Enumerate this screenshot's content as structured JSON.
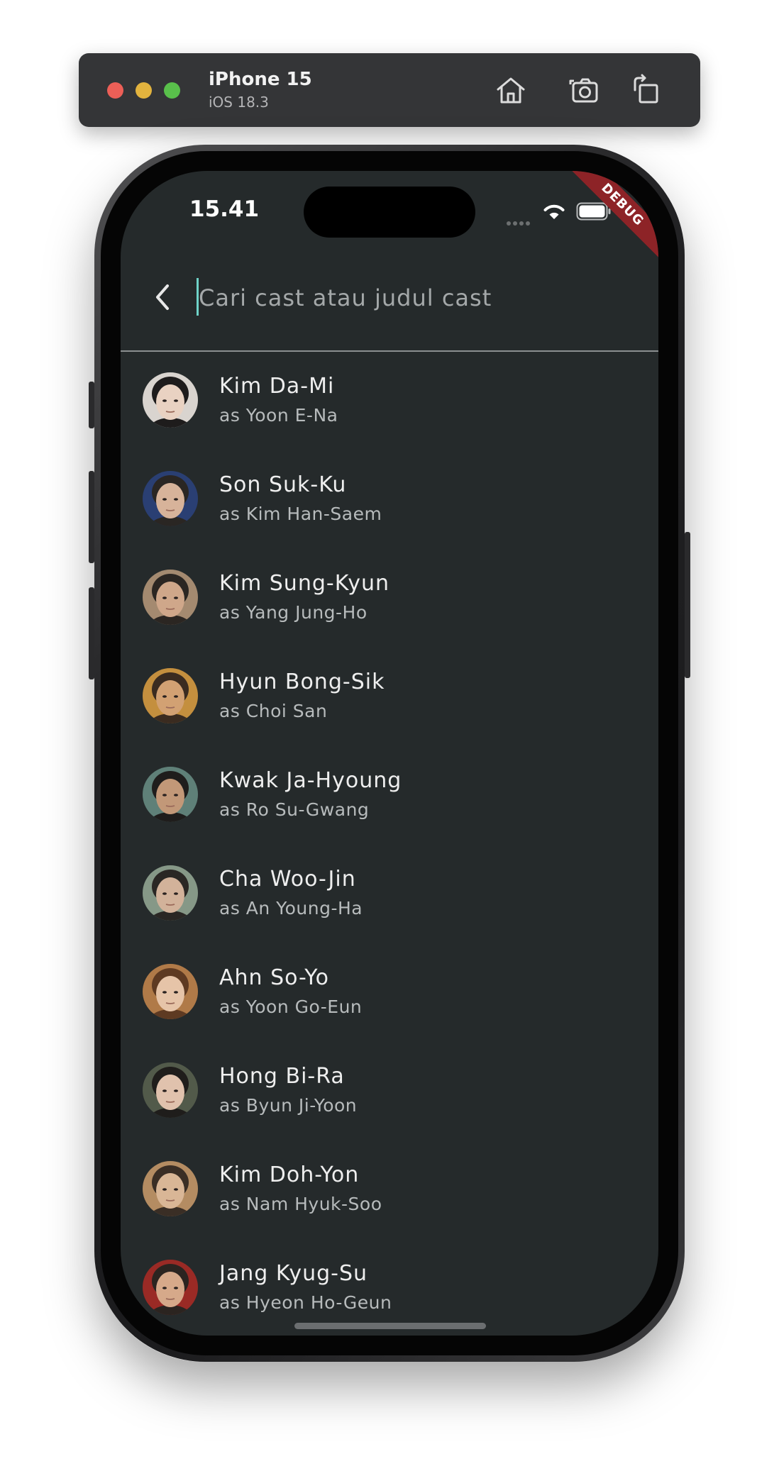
{
  "simulator": {
    "device_name": "iPhone 15",
    "os_version": "iOS 18.3",
    "toolbar_icons": [
      "home-icon",
      "screenshot-icon",
      "rotate-icon"
    ]
  },
  "status_bar": {
    "time": "15.41",
    "debug_label": "DEBUG"
  },
  "appbar": {
    "back_icon": "chevron-left-icon",
    "search_placeholder": "Cari cast atau judul cast",
    "search_value": ""
  },
  "colors": {
    "screen_bg": "#252a2b",
    "accent_caret": "#6fd3c8",
    "debug_banner": "#8d2327",
    "divider": "#8b8f90"
  },
  "cast": [
    {
      "name": "Kim Da-Mi",
      "role": "as Yoon E-Na",
      "avatar_bg": "#d9d4cf",
      "avatar_skin": "#e9d2c2",
      "avatar_hair": "#1e1c1c"
    },
    {
      "name": "Son Suk-Ku",
      "role": "as Kim Han-Saem",
      "avatar_bg": "#2a3f73",
      "avatar_skin": "#d7b39a",
      "avatar_hair": "#2a2623"
    },
    {
      "name": "Kim Sung-Kyun",
      "role": "as Yang Jung-Ho",
      "avatar_bg": "#a48a70",
      "avatar_skin": "#cfa78a",
      "avatar_hair": "#2b2622"
    },
    {
      "name": "Hyun Bong-Sik",
      "role": "as Choi San",
      "avatar_bg": "#c48f3e",
      "avatar_skin": "#d2a173",
      "avatar_hair": "#3a2b20"
    },
    {
      "name": "Kwak Ja-Hyoung",
      "role": "as Ro Su-Gwang",
      "avatar_bg": "#5f8078",
      "avatar_skin": "#c29878",
      "avatar_hair": "#1f1d1c"
    },
    {
      "name": "Cha Woo-Jin",
      "role": "as An Young-Ha",
      "avatar_bg": "#869887",
      "avatar_skin": "#d2b29a",
      "avatar_hair": "#2a2724"
    },
    {
      "name": "Ahn So-Yo",
      "role": "as Yoon Go-Eun",
      "avatar_bg": "#b07a48",
      "avatar_skin": "#e6c4a8",
      "avatar_hair": "#5e3a22"
    },
    {
      "name": "Hong Bi-Ra",
      "role": "as Byun Ji-Yoon",
      "avatar_bg": "#525a4a",
      "avatar_skin": "#e0c2ad",
      "avatar_hair": "#1f1d1b"
    },
    {
      "name": "Kim Doh-Yon",
      "role": "as Nam Hyuk-Soo",
      "avatar_bg": "#b48c62",
      "avatar_skin": "#d9b696",
      "avatar_hair": "#3a2e25"
    },
    {
      "name": "Jang Kyug-Su",
      "role": "as Hyeon Ho-Geun",
      "avatar_bg": "#9a2a25",
      "avatar_skin": "#d6a98a",
      "avatar_hair": "#2b2420"
    }
  ]
}
